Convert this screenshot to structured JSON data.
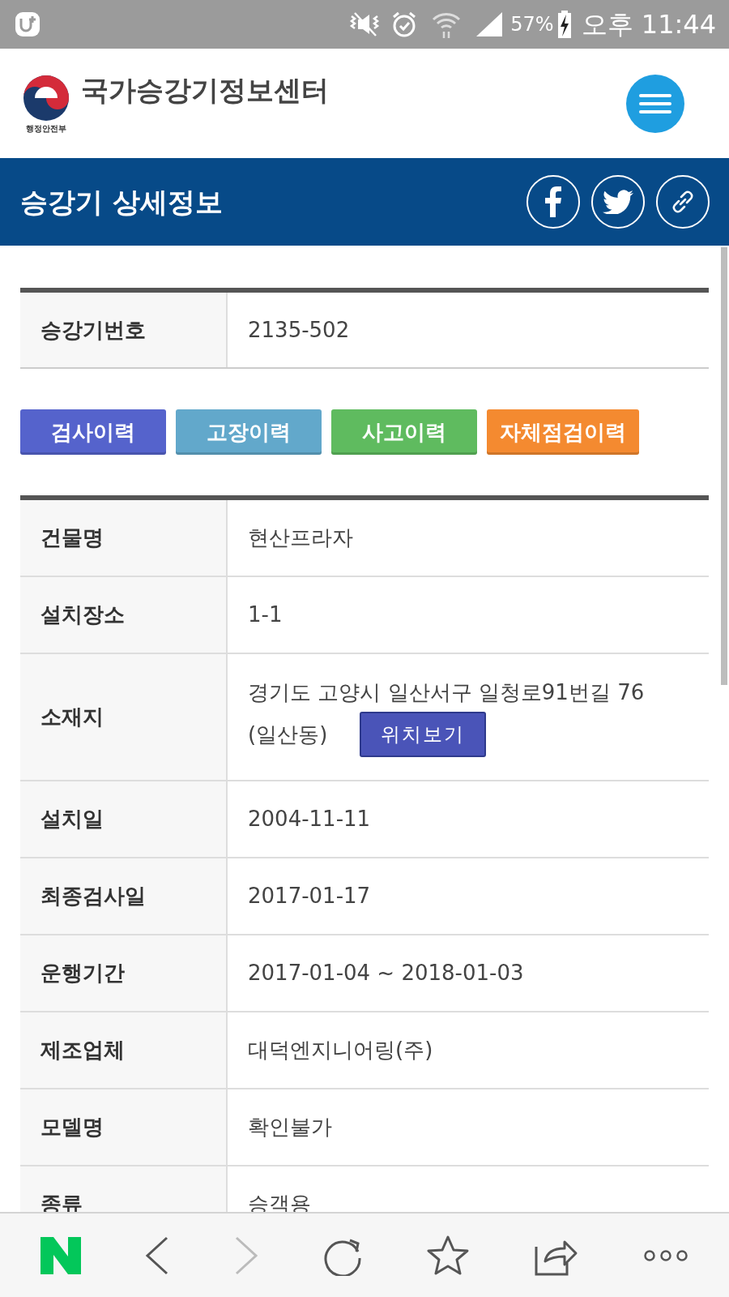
{
  "status_bar": {
    "battery": "57%",
    "time": "오후 11:44"
  },
  "header": {
    "ministry": "행정안전부",
    "site_title": "국가승강기정보센터"
  },
  "title_bar": {
    "title": "승강기 상세정보"
  },
  "id_table": {
    "label": "승강기번호",
    "value": "2135-502"
  },
  "history_buttons": [
    {
      "label": "검사이력",
      "color": "#5563cc"
    },
    {
      "label": "고장이력",
      "color": "#62a8cb"
    },
    {
      "label": "사고이력",
      "color": "#5fbb5f"
    },
    {
      "label": "자체점검이력",
      "color": "#f48a30"
    }
  ],
  "details": [
    {
      "label": "건물명",
      "value": "현산프라자"
    },
    {
      "label": "설치장소",
      "value": "1-1"
    },
    {
      "label": "소재지",
      "value": "경기도 고양시 일산서구 일청로91번길 76",
      "value_2": "(일산동)",
      "button": "위치보기"
    },
    {
      "label": "설치일",
      "value": "2004-11-11"
    },
    {
      "label": "최종검사일",
      "value": "2017-01-17"
    },
    {
      "label": "운행기간",
      "value": "2017-01-04 ~ 2018-01-03"
    },
    {
      "label": "제조업체",
      "value": "대덕엔지니어링(주)"
    },
    {
      "label": "모델명",
      "value": "확인불가"
    },
    {
      "label": "종류",
      "value": "승객용"
    }
  ]
}
